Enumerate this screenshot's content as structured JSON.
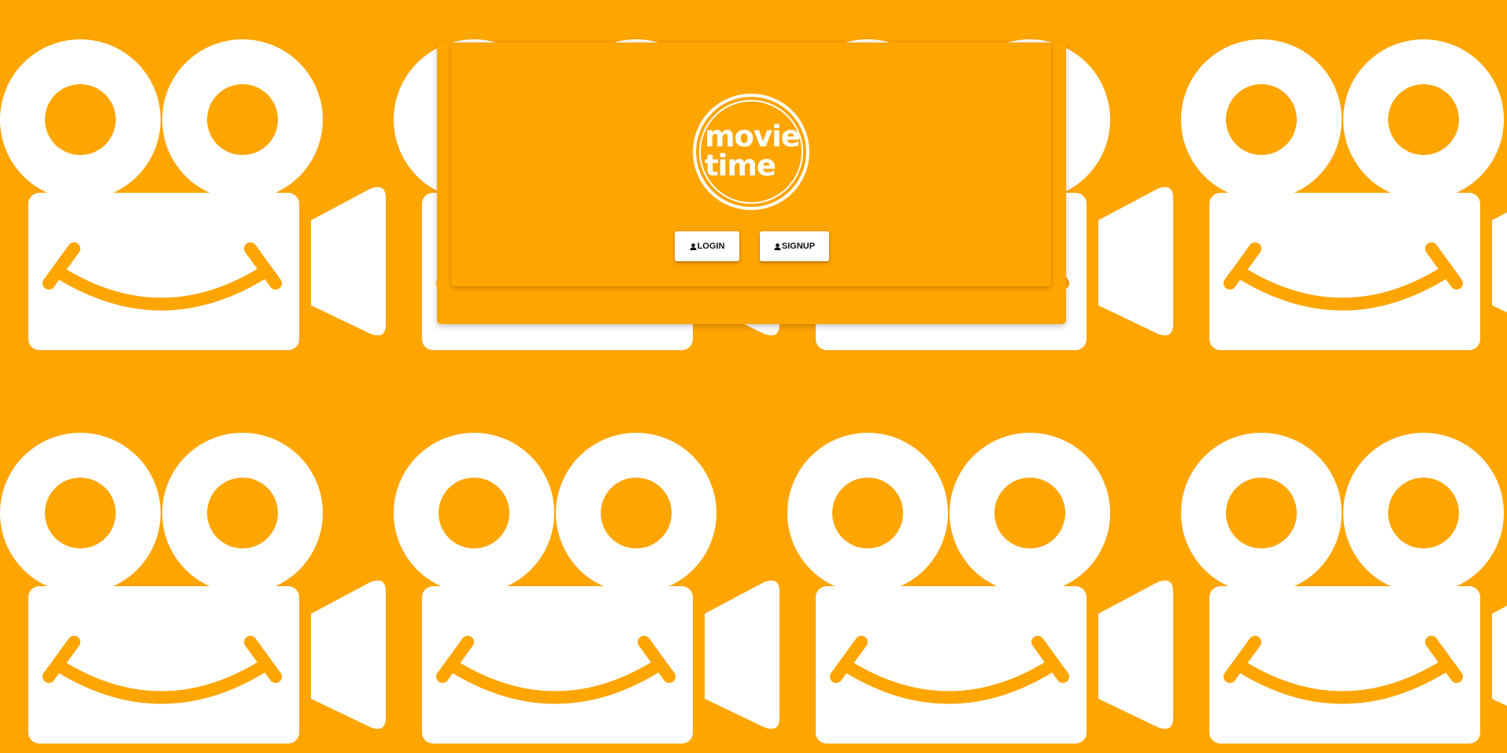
{
  "app": {
    "logo_line1": "movie",
    "logo_line2": "time"
  },
  "buttons": {
    "login_label": "LOGIN",
    "signup_label": "SIGNUP"
  },
  "icons": {
    "background_pattern": "film-camera-icon",
    "button_icon": "user-icon"
  },
  "colors": {
    "background": "#FFA500",
    "pattern": "#FFFFFF",
    "button_background": "#FFFFFF"
  }
}
